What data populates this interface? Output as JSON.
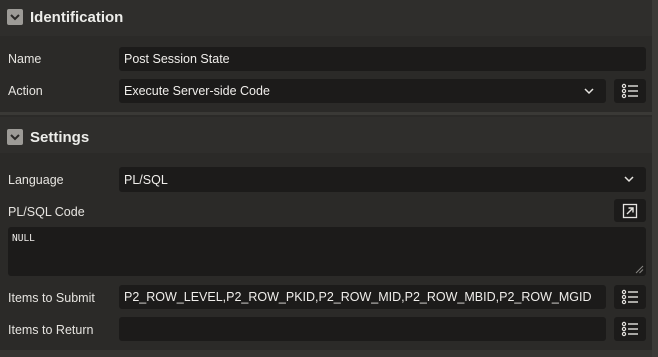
{
  "identification": {
    "title": "Identification",
    "name_label": "Name",
    "name_value": "Post Session State",
    "action_label": "Action",
    "action_value": "Execute Server-side Code"
  },
  "settings": {
    "title": "Settings",
    "language_label": "Language",
    "language_value": "PL/SQL",
    "code_label": "PL/SQL Code",
    "code_value": "NULL",
    "items_submit_label": "Items to Submit",
    "items_submit_value": "P2_ROW_LEVEL,P2_ROW_PKID,P2_ROW_MID,P2_ROW_MBID,P2_ROW_MGID",
    "items_return_label": "Items to Return",
    "items_return_value": ""
  },
  "icons": {
    "collapse": "chevron-down-icon",
    "dropdown": "chevron-down-icon",
    "list_picker": "list-icon",
    "expand_editor": "expand-icon"
  },
  "colors": {
    "background": "#2b2a28",
    "field_background": "#1c1b1a",
    "text": "#e8e6e3"
  }
}
